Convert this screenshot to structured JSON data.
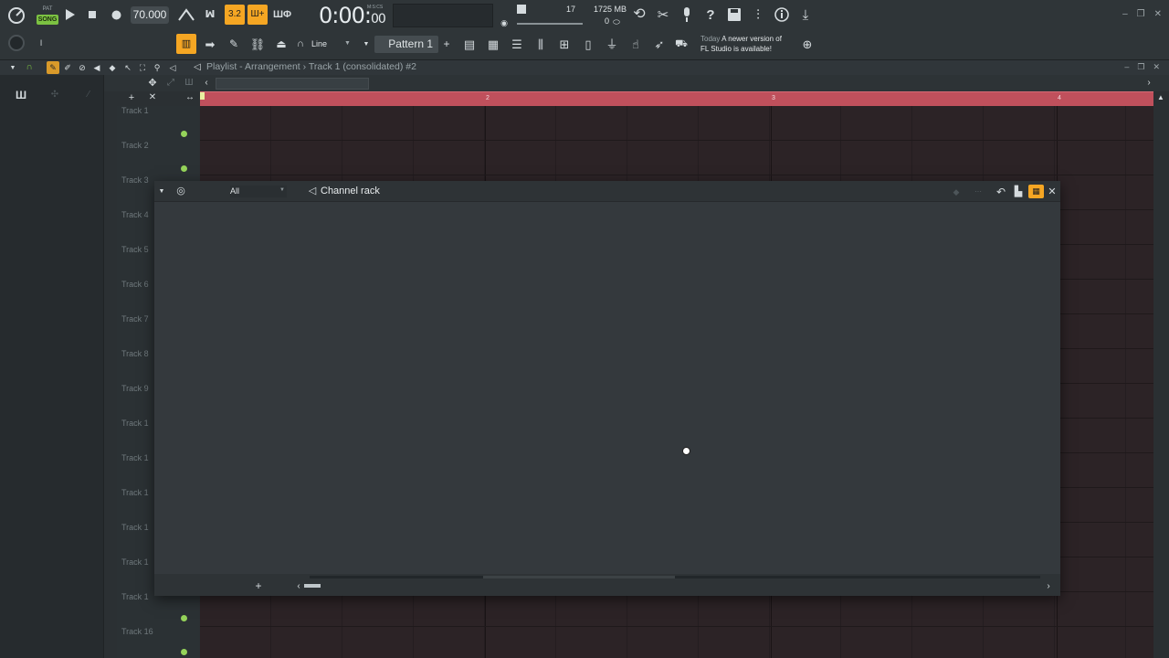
{
  "toolbar": {
    "pat_label": "PAT",
    "song_label": "SONG",
    "tempo": "70.000",
    "time_main": "0:00:",
    "time_small": "00",
    "time_unit": "M:S:CS",
    "cpu": "17",
    "memory": "1725 MB",
    "polyphony": "0",
    "pattern_label": "Pattern 1",
    "snap_label": "Line",
    "news_today": "Today",
    "news_line1": "A newer version of",
    "news_line2": "FL Studio is available!"
  },
  "playlist": {
    "title": "Playlist - Arrangement › Track 1 (consolidated) #2",
    "bar_numbers": [
      "2",
      "3",
      "4"
    ],
    "tracks": [
      "Track 1",
      "Track 2",
      "Track 3",
      "Track 4",
      "Track 5",
      "Track 6",
      "Track 7",
      "Track 8",
      "Track 9",
      "Track 1",
      "Track 1",
      "Track 1",
      "Track 1",
      "Track 1",
      "Track 1",
      "Track 16"
    ]
  },
  "channel_rack": {
    "title": "Channel rack",
    "filter": "All"
  },
  "colors": {
    "accent": "#f5a623",
    "song_green": "#7cc242",
    "timeline": "#c0505c",
    "track_dot": "#95d35a"
  },
  "icons": [
    "pitch-knob-icon",
    "play-icon",
    "stop-icon",
    "record-icon",
    "metronome-icon",
    "countdown-icon",
    "step-edit-icon",
    "typing-keyboard-icon",
    "undo-icon",
    "cut-icon",
    "mic-icon",
    "help-icon",
    "save-icon",
    "mixer-icon",
    "info-icon",
    "download-icon",
    "piano-roll-icon",
    "playlist-icon",
    "channel-rack-icon",
    "plugin-icon",
    "globe-icon",
    "close-icon"
  ]
}
